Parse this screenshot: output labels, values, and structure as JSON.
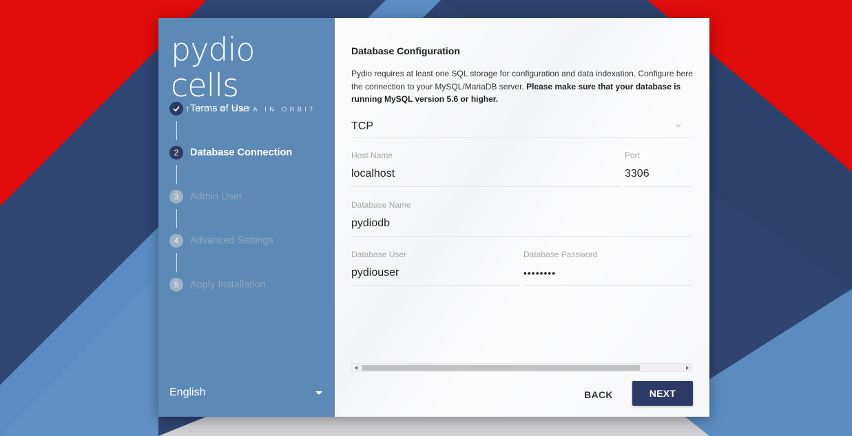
{
  "brand": {
    "logo_text": "pydio cells",
    "tagline": "PUT YOUR DATA IN ORBIT"
  },
  "steps": [
    {
      "number": "1",
      "label": "Terms of Use",
      "state": "done"
    },
    {
      "number": "2",
      "label": "Database Connection",
      "state": "active"
    },
    {
      "number": "3",
      "label": "Admin User",
      "state": "todo"
    },
    {
      "number": "4",
      "label": "Advanced Settings",
      "state": "todo"
    },
    {
      "number": "5",
      "label": "Apply Installation",
      "state": "todo"
    }
  ],
  "language": {
    "selected": "English"
  },
  "form": {
    "title": "Database Configuration",
    "description_plain": "Pydio requires at least one SQL storage for configuration and data indexation. Configure here the connection to your MySQL/MariaDB server. ",
    "description_bold": "Please make sure that your database is running MySQL version 5.6 or higher.",
    "connection_type": "TCP",
    "host": {
      "label": "Host Name",
      "value": "localhost"
    },
    "port": {
      "label": "Port",
      "value": "3306"
    },
    "db_name": {
      "label": "Database Name",
      "value": "pydiodb"
    },
    "db_user": {
      "label": "Database User",
      "value": "pydiouser"
    },
    "db_password": {
      "label": "Database Password",
      "value": "••••••••"
    }
  },
  "buttons": {
    "back": "BACK",
    "next": "NEXT"
  },
  "colors": {
    "primary": "#2e3a66",
    "sidebar": "#5d89b6",
    "background_red": "#e10a0a",
    "background_navy": "#2c4066",
    "background_light_blue": "#5d8dbf"
  },
  "icons": {
    "done_step": "check-icon",
    "dropdown": "caret-down-icon"
  }
}
